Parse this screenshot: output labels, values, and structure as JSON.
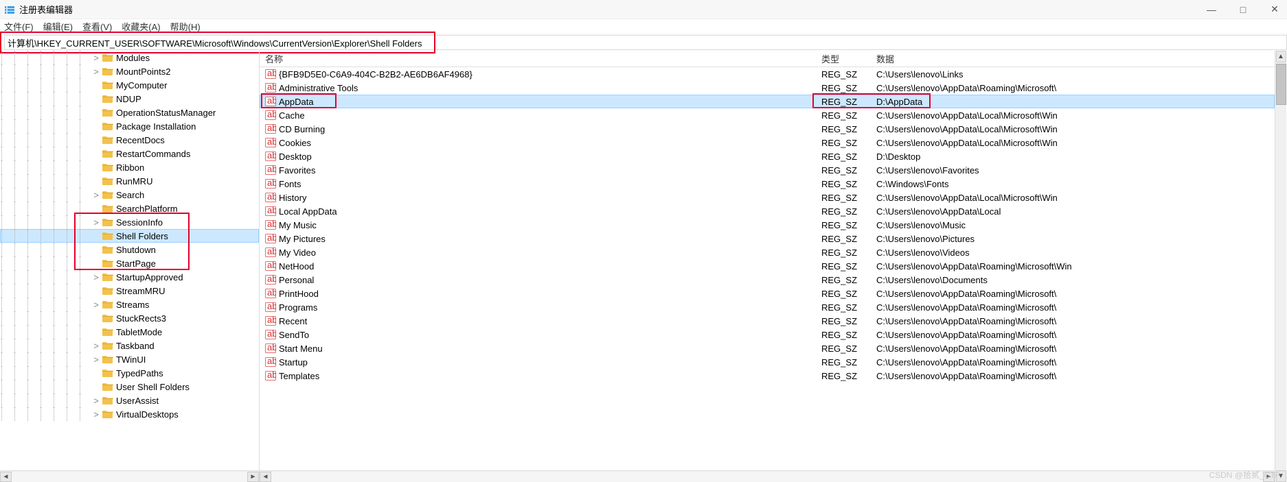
{
  "window": {
    "title": "注册表编辑器",
    "min": "—",
    "max": "□",
    "close": "✕"
  },
  "menu": {
    "file": "文件(F)",
    "edit": "编辑(E)",
    "view": "查看(V)",
    "fav": "收藏夹(A)",
    "help": "帮助(H)"
  },
  "address": "计算机\\HKEY_CURRENT_USER\\SOFTWARE\\Microsoft\\Windows\\CurrentVersion\\Explorer\\Shell Folders",
  "tree": [
    {
      "indent": 7,
      "expander": ">",
      "label": "Modules"
    },
    {
      "indent": 7,
      "expander": ">",
      "label": "MountPoints2"
    },
    {
      "indent": 7,
      "expander": "",
      "label": "MyComputer"
    },
    {
      "indent": 7,
      "expander": "",
      "label": "NDUP"
    },
    {
      "indent": 7,
      "expander": "",
      "label": "OperationStatusManager"
    },
    {
      "indent": 7,
      "expander": "",
      "label": "Package Installation"
    },
    {
      "indent": 7,
      "expander": "",
      "label": "RecentDocs"
    },
    {
      "indent": 7,
      "expander": "",
      "label": "RestartCommands"
    },
    {
      "indent": 7,
      "expander": "",
      "label": "Ribbon"
    },
    {
      "indent": 7,
      "expander": "",
      "label": "RunMRU"
    },
    {
      "indent": 7,
      "expander": ">",
      "label": "Search"
    },
    {
      "indent": 7,
      "expander": "",
      "label": "SearchPlatform"
    },
    {
      "indent": 7,
      "expander": ">",
      "label": "SessionInfo"
    },
    {
      "indent": 7,
      "expander": "",
      "label": "Shell Folders",
      "selected": true
    },
    {
      "indent": 7,
      "expander": "",
      "label": "Shutdown"
    },
    {
      "indent": 7,
      "expander": "",
      "label": "StartPage"
    },
    {
      "indent": 7,
      "expander": ">",
      "label": "StartupApproved"
    },
    {
      "indent": 7,
      "expander": "",
      "label": "StreamMRU"
    },
    {
      "indent": 7,
      "expander": ">",
      "label": "Streams"
    },
    {
      "indent": 7,
      "expander": "",
      "label": "StuckRects3"
    },
    {
      "indent": 7,
      "expander": "",
      "label": "TabletMode"
    },
    {
      "indent": 7,
      "expander": ">",
      "label": "Taskband"
    },
    {
      "indent": 7,
      "expander": ">",
      "label": "TWinUI"
    },
    {
      "indent": 7,
      "expander": "",
      "label": "TypedPaths"
    },
    {
      "indent": 7,
      "expander": "",
      "label": "User Shell Folders"
    },
    {
      "indent": 7,
      "expander": ">",
      "label": "UserAssist"
    },
    {
      "indent": 7,
      "expander": ">",
      "label": "VirtualDesktops"
    }
  ],
  "list_headers": {
    "name": "名称",
    "type": "类型",
    "data": "数据"
  },
  "values": [
    {
      "name": "{BFB9D5E0-C6A9-404C-B2B2-AE6DB6AF4968}",
      "type": "REG_SZ",
      "data": "C:\\Users\\lenovo\\Links"
    },
    {
      "name": "Administrative Tools",
      "type": "REG_SZ",
      "data": "C:\\Users\\lenovo\\AppData\\Roaming\\Microsoft\\"
    },
    {
      "name": "AppData",
      "type": "REG_SZ",
      "data": "D:\\AppData",
      "selected": true
    },
    {
      "name": "Cache",
      "type": "REG_SZ",
      "data": "C:\\Users\\lenovo\\AppData\\Local\\Microsoft\\Win"
    },
    {
      "name": "CD Burning",
      "type": "REG_SZ",
      "data": "C:\\Users\\lenovo\\AppData\\Local\\Microsoft\\Win"
    },
    {
      "name": "Cookies",
      "type": "REG_SZ",
      "data": "C:\\Users\\lenovo\\AppData\\Local\\Microsoft\\Win"
    },
    {
      "name": "Desktop",
      "type": "REG_SZ",
      "data": "D:\\Desktop"
    },
    {
      "name": "Favorites",
      "type": "REG_SZ",
      "data": "C:\\Users\\lenovo\\Favorites"
    },
    {
      "name": "Fonts",
      "type": "REG_SZ",
      "data": "C:\\Windows\\Fonts"
    },
    {
      "name": "History",
      "type": "REG_SZ",
      "data": "C:\\Users\\lenovo\\AppData\\Local\\Microsoft\\Win"
    },
    {
      "name": "Local AppData",
      "type": "REG_SZ",
      "data": "C:\\Users\\lenovo\\AppData\\Local"
    },
    {
      "name": "My Music",
      "type": "REG_SZ",
      "data": "C:\\Users\\lenovo\\Music"
    },
    {
      "name": "My Pictures",
      "type": "REG_SZ",
      "data": "C:\\Users\\lenovo\\Pictures"
    },
    {
      "name": "My Video",
      "type": "REG_SZ",
      "data": "C:\\Users\\lenovo\\Videos"
    },
    {
      "name": "NetHood",
      "type": "REG_SZ",
      "data": "C:\\Users\\lenovo\\AppData\\Roaming\\Microsoft\\Win"
    },
    {
      "name": "Personal",
      "type": "REG_SZ",
      "data": "C:\\Users\\lenovo\\Documents"
    },
    {
      "name": "PrintHood",
      "type": "REG_SZ",
      "data": "C:\\Users\\lenovo\\AppData\\Roaming\\Microsoft\\"
    },
    {
      "name": "Programs",
      "type": "REG_SZ",
      "data": "C:\\Users\\lenovo\\AppData\\Roaming\\Microsoft\\"
    },
    {
      "name": "Recent",
      "type": "REG_SZ",
      "data": "C:\\Users\\lenovo\\AppData\\Roaming\\Microsoft\\"
    },
    {
      "name": "SendTo",
      "type": "REG_SZ",
      "data": "C:\\Users\\lenovo\\AppData\\Roaming\\Microsoft\\"
    },
    {
      "name": "Start Menu",
      "type": "REG_SZ",
      "data": "C:\\Users\\lenovo\\AppData\\Roaming\\Microsoft\\"
    },
    {
      "name": "Startup",
      "type": "REG_SZ",
      "data": "C:\\Users\\lenovo\\AppData\\Roaming\\Microsoft\\"
    },
    {
      "name": "Templates",
      "type": "REG_SZ",
      "data": "C:\\Users\\lenovo\\AppData\\Roaming\\Microsoft\\"
    }
  ],
  "watermark": "CSDN @拾贰_CTF"
}
